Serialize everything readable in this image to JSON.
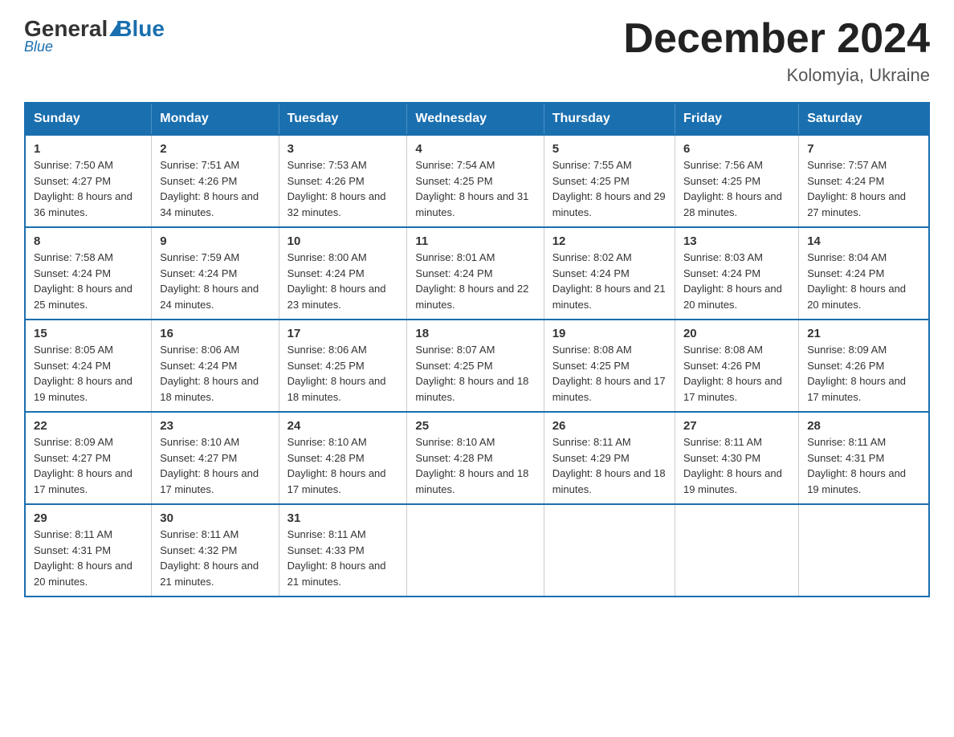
{
  "header": {
    "logo": {
      "general": "General",
      "blue": "Blue"
    },
    "title": "December 2024",
    "location": "Kolomyia, Ukraine"
  },
  "weekdays": [
    "Sunday",
    "Monday",
    "Tuesday",
    "Wednesday",
    "Thursday",
    "Friday",
    "Saturday"
  ],
  "weeks": [
    [
      {
        "day": "1",
        "sunrise": "7:50 AM",
        "sunset": "4:27 PM",
        "daylight": "8 hours and 36 minutes."
      },
      {
        "day": "2",
        "sunrise": "7:51 AM",
        "sunset": "4:26 PM",
        "daylight": "8 hours and 34 minutes."
      },
      {
        "day": "3",
        "sunrise": "7:53 AM",
        "sunset": "4:26 PM",
        "daylight": "8 hours and 32 minutes."
      },
      {
        "day": "4",
        "sunrise": "7:54 AM",
        "sunset": "4:25 PM",
        "daylight": "8 hours and 31 minutes."
      },
      {
        "day": "5",
        "sunrise": "7:55 AM",
        "sunset": "4:25 PM",
        "daylight": "8 hours and 29 minutes."
      },
      {
        "day": "6",
        "sunrise": "7:56 AM",
        "sunset": "4:25 PM",
        "daylight": "8 hours and 28 minutes."
      },
      {
        "day": "7",
        "sunrise": "7:57 AM",
        "sunset": "4:24 PM",
        "daylight": "8 hours and 27 minutes."
      }
    ],
    [
      {
        "day": "8",
        "sunrise": "7:58 AM",
        "sunset": "4:24 PM",
        "daylight": "8 hours and 25 minutes."
      },
      {
        "day": "9",
        "sunrise": "7:59 AM",
        "sunset": "4:24 PM",
        "daylight": "8 hours and 24 minutes."
      },
      {
        "day": "10",
        "sunrise": "8:00 AM",
        "sunset": "4:24 PM",
        "daylight": "8 hours and 23 minutes."
      },
      {
        "day": "11",
        "sunrise": "8:01 AM",
        "sunset": "4:24 PM",
        "daylight": "8 hours and 22 minutes."
      },
      {
        "day": "12",
        "sunrise": "8:02 AM",
        "sunset": "4:24 PM",
        "daylight": "8 hours and 21 minutes."
      },
      {
        "day": "13",
        "sunrise": "8:03 AM",
        "sunset": "4:24 PM",
        "daylight": "8 hours and 20 minutes."
      },
      {
        "day": "14",
        "sunrise": "8:04 AM",
        "sunset": "4:24 PM",
        "daylight": "8 hours and 20 minutes."
      }
    ],
    [
      {
        "day": "15",
        "sunrise": "8:05 AM",
        "sunset": "4:24 PM",
        "daylight": "8 hours and 19 minutes."
      },
      {
        "day": "16",
        "sunrise": "8:06 AM",
        "sunset": "4:24 PM",
        "daylight": "8 hours and 18 minutes."
      },
      {
        "day": "17",
        "sunrise": "8:06 AM",
        "sunset": "4:25 PM",
        "daylight": "8 hours and 18 minutes."
      },
      {
        "day": "18",
        "sunrise": "8:07 AM",
        "sunset": "4:25 PM",
        "daylight": "8 hours and 18 minutes."
      },
      {
        "day": "19",
        "sunrise": "8:08 AM",
        "sunset": "4:25 PM",
        "daylight": "8 hours and 17 minutes."
      },
      {
        "day": "20",
        "sunrise": "8:08 AM",
        "sunset": "4:26 PM",
        "daylight": "8 hours and 17 minutes."
      },
      {
        "day": "21",
        "sunrise": "8:09 AM",
        "sunset": "4:26 PM",
        "daylight": "8 hours and 17 minutes."
      }
    ],
    [
      {
        "day": "22",
        "sunrise": "8:09 AM",
        "sunset": "4:27 PM",
        "daylight": "8 hours and 17 minutes."
      },
      {
        "day": "23",
        "sunrise": "8:10 AM",
        "sunset": "4:27 PM",
        "daylight": "8 hours and 17 minutes."
      },
      {
        "day": "24",
        "sunrise": "8:10 AM",
        "sunset": "4:28 PM",
        "daylight": "8 hours and 17 minutes."
      },
      {
        "day": "25",
        "sunrise": "8:10 AM",
        "sunset": "4:28 PM",
        "daylight": "8 hours and 18 minutes."
      },
      {
        "day": "26",
        "sunrise": "8:11 AM",
        "sunset": "4:29 PM",
        "daylight": "8 hours and 18 minutes."
      },
      {
        "day": "27",
        "sunrise": "8:11 AM",
        "sunset": "4:30 PM",
        "daylight": "8 hours and 19 minutes."
      },
      {
        "day": "28",
        "sunrise": "8:11 AM",
        "sunset": "4:31 PM",
        "daylight": "8 hours and 19 minutes."
      }
    ],
    [
      {
        "day": "29",
        "sunrise": "8:11 AM",
        "sunset": "4:31 PM",
        "daylight": "8 hours and 20 minutes."
      },
      {
        "day": "30",
        "sunrise": "8:11 AM",
        "sunset": "4:32 PM",
        "daylight": "8 hours and 21 minutes."
      },
      {
        "day": "31",
        "sunrise": "8:11 AM",
        "sunset": "4:33 PM",
        "daylight": "8 hours and 21 minutes."
      },
      null,
      null,
      null,
      null
    ]
  ]
}
